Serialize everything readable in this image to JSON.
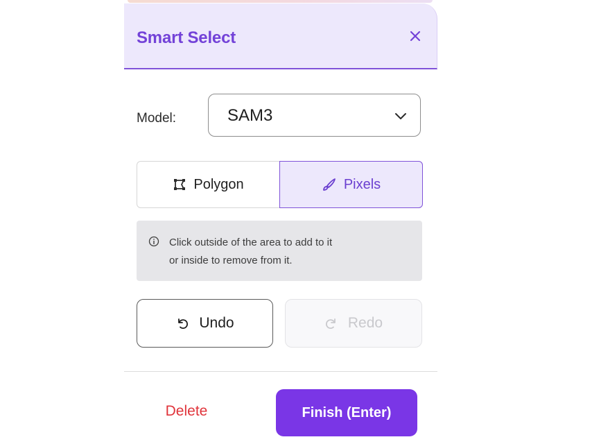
{
  "panel": {
    "title": "Smart Select",
    "close_icon": "close-icon"
  },
  "model": {
    "label": "Model:",
    "selected": "SAM3"
  },
  "mode": {
    "options": [
      {
        "label": "Polygon",
        "icon": "polygon-icon",
        "selected": false
      },
      {
        "label": "Pixels",
        "icon": "brush-icon",
        "selected": true
      }
    ]
  },
  "info": {
    "line1": "Click outside of the area to add to it",
    "line2": "or inside to remove from it."
  },
  "history": {
    "undo_label": "Undo",
    "redo_label": "Redo",
    "redo_enabled": false
  },
  "footer": {
    "delete_label": "Delete",
    "finish_label": "Finish (Enter)"
  },
  "colors": {
    "accent": "#7a36e6",
    "header_bg": "#ede8fc",
    "title": "#7342d8",
    "danger": "#e0343b"
  }
}
